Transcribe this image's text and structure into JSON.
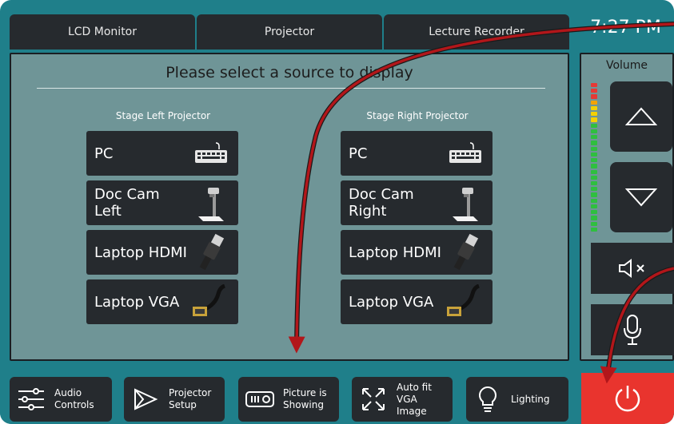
{
  "clock": "7:27 PM",
  "tabs": [
    {
      "label": "LCD Monitor"
    },
    {
      "label": "Projector"
    },
    {
      "label": "Lecture Recorder"
    }
  ],
  "main": {
    "title": "Please select a source to display",
    "columns": [
      {
        "title": "Stage Left Projector",
        "sources": [
          {
            "label": "PC",
            "icon": "keyboard-icon"
          },
          {
            "label": "Doc Cam Left",
            "icon": "document-camera-icon"
          },
          {
            "label": "Laptop HDMI",
            "icon": "hdmi-cable-icon"
          },
          {
            "label": "Laptop VGA",
            "icon": "vga-cable-icon"
          }
        ]
      },
      {
        "title": "Stage Right Projector",
        "sources": [
          {
            "label": "PC",
            "icon": "keyboard-icon"
          },
          {
            "label": "Doc Cam Right",
            "icon": "document-camera-icon"
          },
          {
            "label": "Laptop HDMI",
            "icon": "hdmi-cable-icon"
          },
          {
            "label": "Laptop VGA",
            "icon": "vga-cable-icon"
          }
        ]
      }
    ]
  },
  "volume": {
    "label": "Volume",
    "up_icon": "triangle-up-icon",
    "down_icon": "triangle-down-icon",
    "mute_icon": "speaker-mute-icon",
    "mic_icon": "microphone-icon",
    "meter_colors": [
      "#e53935",
      "#e53935",
      "#e53935",
      "#f4a300",
      "#f4d000",
      "#f4d000",
      "#f4d000",
      "#2fbf3f",
      "#2fbf3f",
      "#2fbf3f",
      "#2fbf3f",
      "#2fbf3f",
      "#2fbf3f",
      "#2fbf3f",
      "#2fbf3f",
      "#2fbf3f",
      "#2fbf3f",
      "#2fbf3f",
      "#2fbf3f",
      "#2fbf3f",
      "#2fbf3f",
      "#2fbf3f",
      "#2fbf3f",
      "#2fbf3f",
      "#2fbf3f",
      "#2fbf3f"
    ]
  },
  "bottom_bar": {
    "buttons": [
      {
        "label": "Audio\nControls",
        "icon": "sliders-icon"
      },
      {
        "label": "Projector\nSetup",
        "icon": "play-outline-icon"
      },
      {
        "label": "Picture is\nShowing",
        "icon": "projector-icon"
      },
      {
        "label": "Auto fit\nVGA\nImage",
        "icon": "expand-arrows-icon"
      },
      {
        "label": "Lighting",
        "icon": "lightbulb-icon"
      }
    ],
    "power_icon": "power-icon"
  },
  "colors": {
    "frame": "#1f7f8a",
    "panel": "#6f9597",
    "button": "#262a2e",
    "power": "#e9342e",
    "annotation_arrow": "#b2161a"
  }
}
